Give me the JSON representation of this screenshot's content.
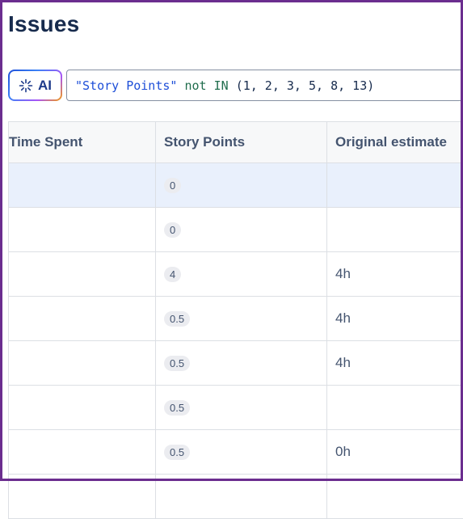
{
  "page": {
    "title": "Issues"
  },
  "ai_button": {
    "label": "AI",
    "icon": "sparkle-icon"
  },
  "query": {
    "field": "\"Story Points\"",
    "operator": "not IN",
    "values": "(1, 2, 3, 5, 8, 13)"
  },
  "table": {
    "columns": [
      "Time Spent",
      "Story Points",
      "Original estimate"
    ],
    "rows": [
      {
        "time_spent": "",
        "story_points": "0",
        "original_estimate": ""
      },
      {
        "time_spent": "",
        "story_points": "0",
        "original_estimate": ""
      },
      {
        "time_spent": "",
        "story_points": "4",
        "original_estimate": "4h"
      },
      {
        "time_spent": "",
        "story_points": "0.5",
        "original_estimate": "4h"
      },
      {
        "time_spent": "",
        "story_points": "0.5",
        "original_estimate": "4h"
      },
      {
        "time_spent": "",
        "story_points": "0.5",
        "original_estimate": ""
      },
      {
        "time_spent": "",
        "story_points": "0.5",
        "original_estimate": "0h"
      }
    ]
  },
  "colors": {
    "frame": "#6b2d8f",
    "selected_row": "#e9f0fc",
    "query_string": "#1d4ed8",
    "query_keyword": "#216e4e"
  }
}
